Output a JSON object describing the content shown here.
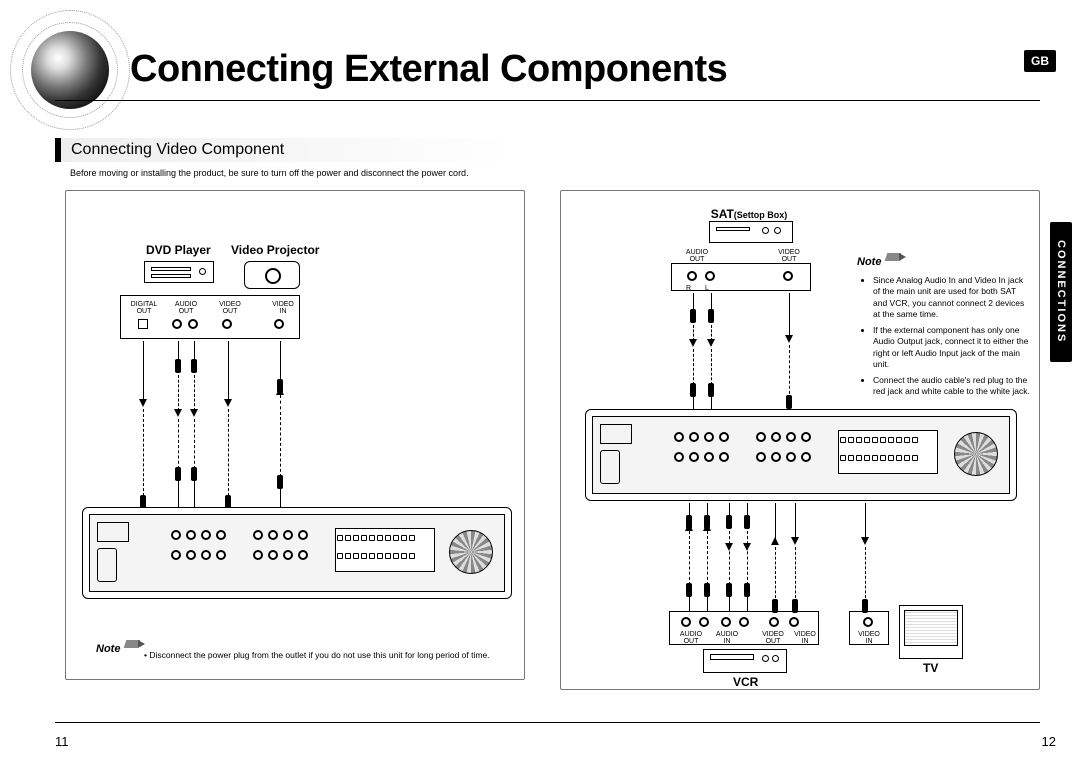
{
  "badge": "GB",
  "title": "Connecting External Components",
  "section_heading": "Connecting Video Component",
  "caution_text": "Before moving or installing the product, be sure to turn off the power and disconnect the power cord.",
  "side_tab": "CONNECTIONS",
  "page_left": "11",
  "page_right": "12",
  "left": {
    "dvd_label": "DVD Player",
    "proj_label": "Video Projector",
    "digital_out": "DIGITAL\nOUT",
    "audio_out": "AUDIO\nOUT",
    "video_out": "VIDEO\nOUT",
    "video_in": "VIDEO\nIN",
    "note_label": "Note",
    "note_bullet": "Disconnect the power plug from the outlet if you do not use this unit for long period of time."
  },
  "right": {
    "sat_label_bold": "SAT",
    "sat_label_small": "(Settop Box)",
    "audio_out": "AUDIO\nOUT",
    "video_out": "VIDEO\nOUT",
    "rl": {
      "r": "R",
      "l": "L"
    },
    "note_label": "Note",
    "notes": [
      "Since Analog Audio In and Video In jack of the main unit are used for both SAT and VCR, you cannot connect 2 devices at the same time.",
      "If the external component has only one Audio Output jack, connect it to either the right or left Audio Input jack of the main unit.",
      "Connect the audio cable's red plug to the red jack and white cable to the white jack."
    ],
    "bottom_labels": {
      "audio_out": "AUDIO\nOUT",
      "audio_in": "AUDIO\nIN",
      "video_out": "VIDEO\nOUT",
      "video_in": "VIDEO\nIN",
      "video_in2": "VIDEO\nIN"
    },
    "vcr_label": "VCR",
    "tv_label": "TV"
  }
}
